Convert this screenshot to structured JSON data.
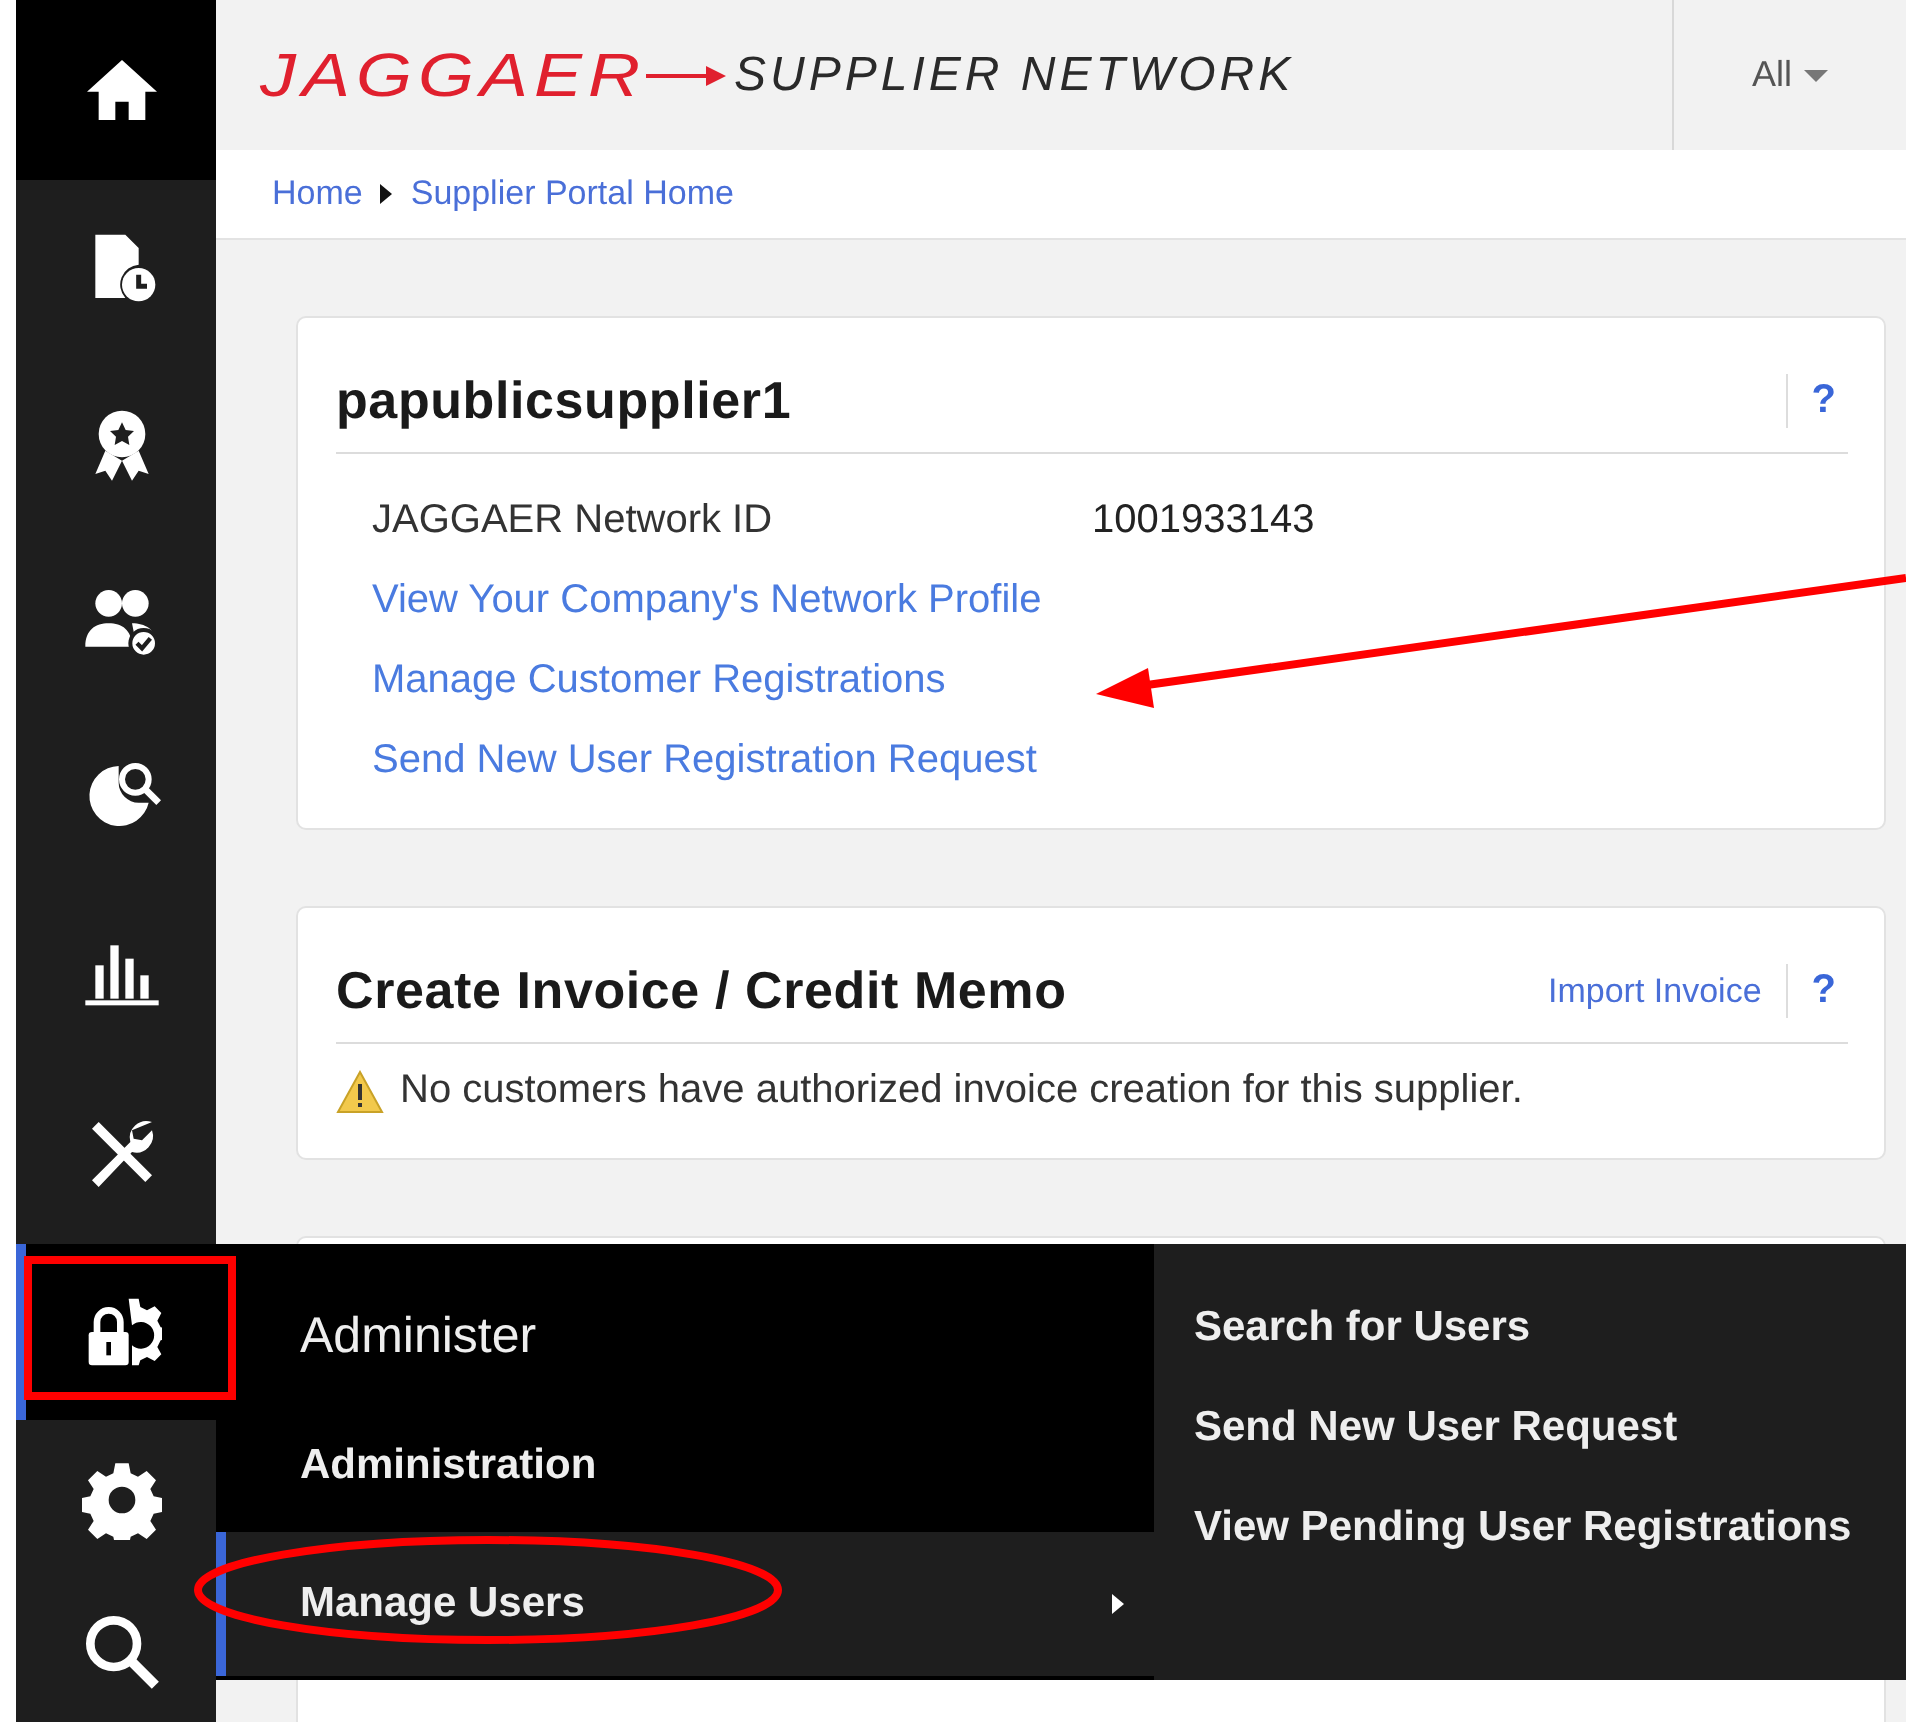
{
  "sidebar": {
    "items": [
      {
        "current": true,
        "selected": false
      },
      {
        "current": false,
        "selected": false
      },
      {
        "current": false,
        "selected": false
      },
      {
        "current": false,
        "selected": false
      },
      {
        "current": false,
        "selected": false
      },
      {
        "current": false,
        "selected": false
      },
      {
        "current": false,
        "selected": false
      },
      {
        "current": false,
        "selected": true
      },
      {
        "current": false,
        "selected": false
      },
      {
        "current": false,
        "selected": false
      }
    ]
  },
  "header": {
    "logo": "JAGGAER",
    "product": "SUPPLIER NETWORK",
    "scope_menu": "All"
  },
  "breadcrumb": [
    "Home",
    "Supplier Portal Home"
  ],
  "cards": [
    {
      "title": "papublicsupplier1",
      "help": "?",
      "fields": [
        {
          "label": "JAGGAER Network ID",
          "value": "1001933143"
        }
      ],
      "links": [
        "View Your Company's Network Profile",
        "Manage Customer Registrations",
        "Send New User Registration Request"
      ]
    },
    {
      "title": "Create Invoice / Credit Memo",
      "action": "Import Invoice",
      "help": "?",
      "notice": {
        "kind": "warning",
        "text": "No customers have authorized invoice creation for this supplier."
      }
    }
  ],
  "flyout": {
    "heading": "Administer",
    "items": [
      {
        "label": "Administration",
        "selected": false,
        "has_submenu": false
      },
      {
        "label": "Manage Users",
        "selected": true,
        "has_submenu": true
      }
    ],
    "submenu": [
      "Search for Users",
      "Send New User Request",
      "View Pending User Registrations"
    ]
  },
  "annotations": [
    {
      "kind": "arrow"
    },
    {
      "kind": "box"
    },
    {
      "kind": "ellipse"
    }
  ]
}
